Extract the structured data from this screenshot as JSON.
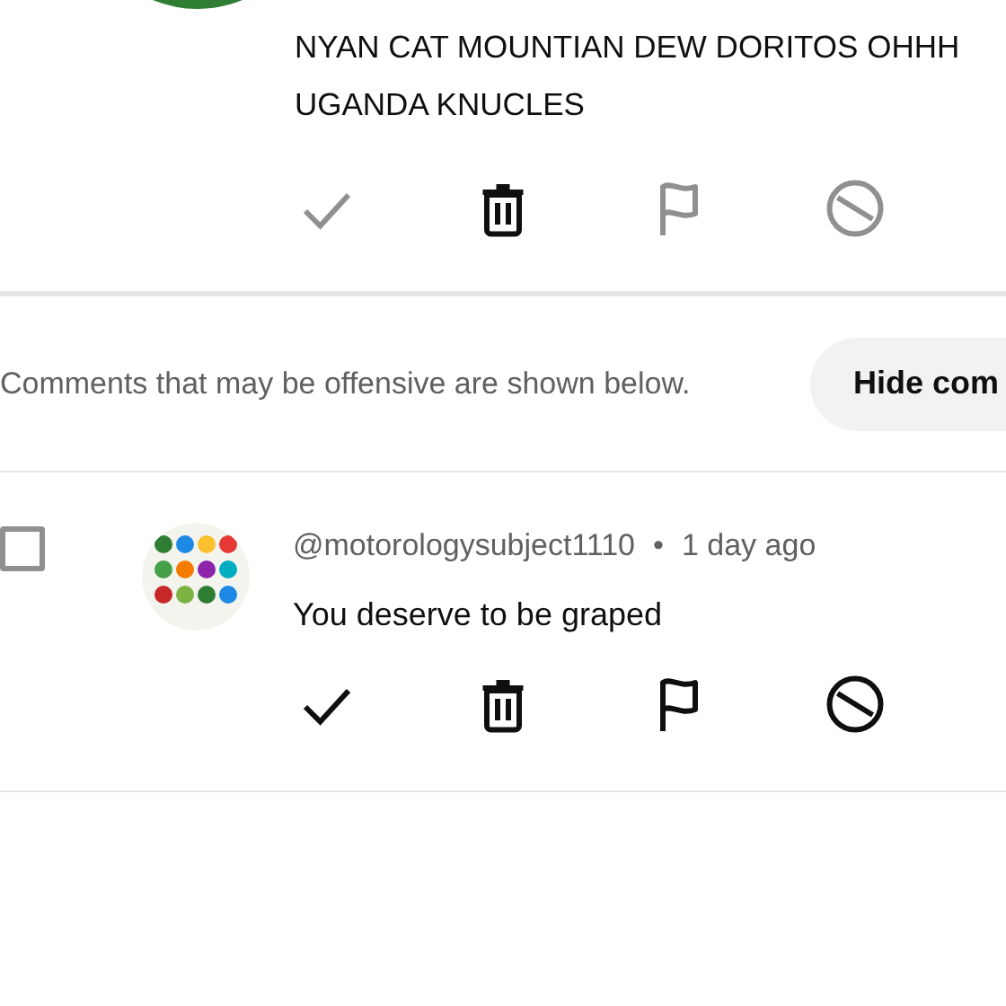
{
  "comments": [
    {
      "text": "NYAN CAT MOUNTIAN DEW DORITOS OHHH UGANDA KNUCLES",
      "actions": [
        {
          "kind": "approve",
          "disabled": true
        },
        {
          "kind": "delete",
          "disabled": false
        },
        {
          "kind": "report",
          "disabled": true
        },
        {
          "kind": "block",
          "disabled": true
        }
      ]
    }
  ],
  "notice": {
    "text": "Comments that may be offensive are shown below.",
    "button": "Hide com"
  },
  "flagged_comments": [
    {
      "checked": false,
      "author": "@motorologysubject1110",
      "separator": "•",
      "time": "1 day ago",
      "text": "You deserve to be graped",
      "actions": [
        {
          "kind": "approve",
          "disabled": false
        },
        {
          "kind": "delete",
          "disabled": false
        },
        {
          "kind": "report",
          "disabled": false
        },
        {
          "kind": "block",
          "disabled": false
        }
      ]
    }
  ]
}
